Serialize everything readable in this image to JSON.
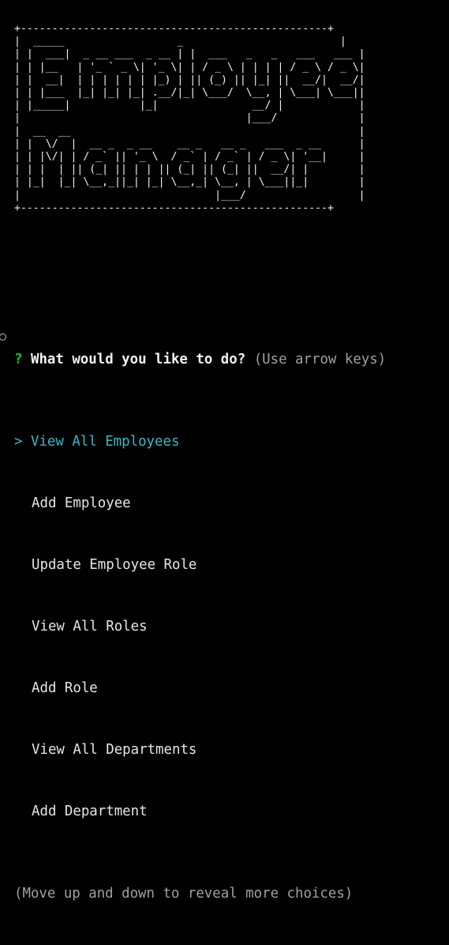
{
  "banner": {
    "ascii": "+-------------------------------------------------+\n|  _____                  _                         |\n| |  ___|  _ __ ___  _ __ | |  ___   _   _   ___   ___ |\n| | |__   | '_ ` _ \\| '_ \\| | / _ \\ | | | | / _ \\ / _ \\|\n| |  __|  | | | | | | |_) | || (_) || |_| ||  __/|  __/|\n| | |___  |_| |_| |_| .__/|_| \\___/  \\__, | \\___| \\___||\n| |_____|           |_|               __/ |            |\n|                                    |___/             |\n|  __  __                                              |\n| |  \\/  |  __ _  _ __    __ _   __ _   ___  _ __      |\n| | |\\/| | / _` || '_ \\  / _` | / _` | / _ \\| '__|     |\n| | |  | || (_| || | | || (_| || (_| ||  __/| |        |\n| |_|  |_| \\__,_||_| |_| \\__,_| \\__, | \\___||_|        |\n|                               |___/                  |\n+-------------------------------------------------+"
  },
  "prompt": {
    "qmark": "?",
    "question": "What would you like to do?",
    "hint": "(Use arrow keys)",
    "pointer": ">",
    "choices": [
      "View All Employees",
      "Add Employee",
      "Update Employee Role",
      "View All Roles",
      "Add Role",
      "View All Departments",
      "Add Department"
    ],
    "selected_index": 0,
    "footer": "(Move up and down to reveal more choices)"
  },
  "colors": {
    "background": "#000000",
    "qmark": "#16c60c",
    "selected": "#3ab7c7",
    "hint": "#a0a0a0",
    "text": "#e6e6e6"
  }
}
